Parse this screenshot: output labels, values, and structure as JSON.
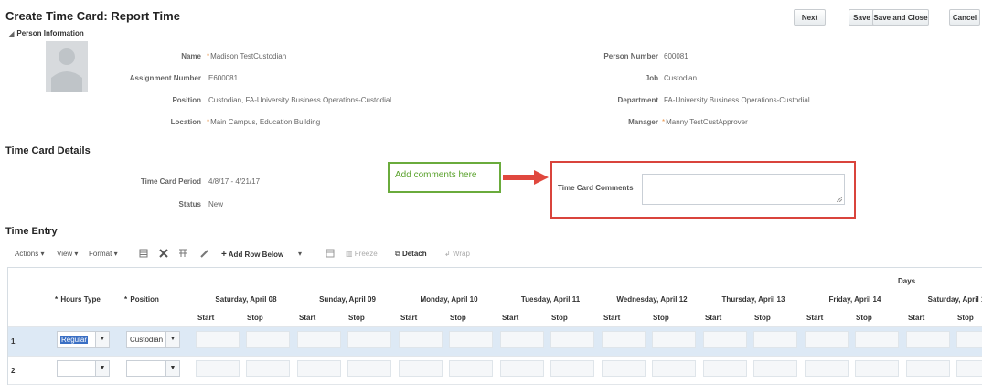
{
  "page": {
    "title": "Create Time Card: Report Time",
    "buttons": {
      "next": "Next",
      "save": "Save",
      "save_close": "Save and Close",
      "cancel": "Cancel"
    }
  },
  "person": {
    "section_label": "Person Information",
    "name_label": "Name",
    "name_value": "Madison TestCustodian",
    "assignment_label": "Assignment Number",
    "assignment_value": "E600081",
    "position_label": "Position",
    "position_value": "Custodian, FA-University Business Operations-Custodial",
    "location_label": "Location",
    "location_value": "Main Campus, Education Building",
    "person_number_label": "Person Number",
    "person_number_value": "600081",
    "job_label": "Job",
    "job_value": "Custodian",
    "department_label": "Department",
    "department_value": "FA-University Business Operations-Custodial",
    "manager_label": "Manager",
    "manager_value": "Manny TestCustApprover"
  },
  "details": {
    "heading": "Time Card Details",
    "period_label": "Time Card Period",
    "period_value": "4/8/17 - 4/21/17",
    "status_label": "Status",
    "status_value": "New",
    "annotation": "Add comments here",
    "comments_label": "Time Card Comments"
  },
  "entry": {
    "heading": "Time Entry",
    "toolbar": {
      "actions": "Actions",
      "view": "View",
      "format": "Format",
      "add_row": "Add Row Below",
      "freeze": "Freeze",
      "detach": "Detach",
      "wrap": "Wrap"
    },
    "group_header": "Days",
    "col_hours_type": "Hours Type",
    "col_position": "Position",
    "days": [
      "Saturday, April 08",
      "Sunday, April 09",
      "Monday, April 10",
      "Tuesday, April 11",
      "Wednesday, April 12",
      "Thursday, April 13",
      "Friday, April 14",
      "Saturday, April 1"
    ],
    "start_label": "Start",
    "stop_label": "Stop",
    "rows": [
      {
        "num": "1",
        "hours_type": "Regular",
        "position": "Custodian"
      },
      {
        "num": "2",
        "hours_type": "",
        "position": ""
      }
    ]
  },
  "colors": {
    "annotation_green": "#5aa22c",
    "highlight_red": "#d9443c",
    "selected_row": "#dde9f5"
  }
}
